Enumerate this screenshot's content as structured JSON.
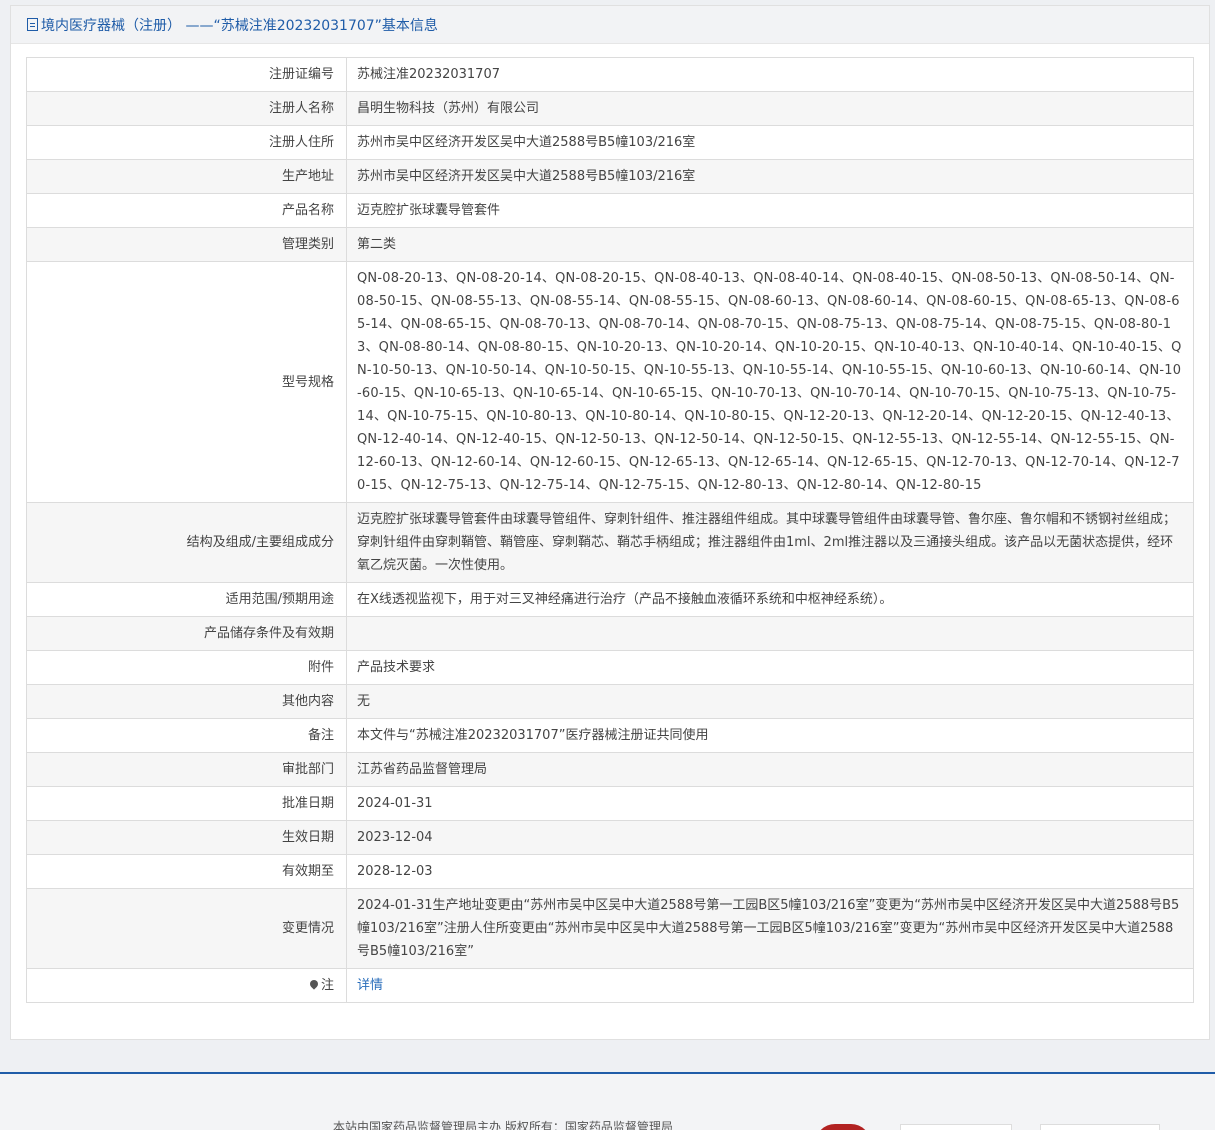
{
  "header": {
    "title": "境内医疗器械（注册） ——“苏械注准20232031707”基本信息"
  },
  "rows": [
    {
      "label": "注册证编号",
      "value": "苏械注准20232031707"
    },
    {
      "label": "注册人名称",
      "value": "昌明生物科技（苏州）有限公司"
    },
    {
      "label": "注册人住所",
      "value": "苏州市吴中区经济开发区吴中大道2588号B5幢103/216室"
    },
    {
      "label": "生产地址",
      "value": "苏州市吴中区经济开发区吴中大道2588号B5幢103/216室"
    },
    {
      "label": "产品名称",
      "value": "迈克腔扩张球囊导管套件"
    },
    {
      "label": "管理类别",
      "value": "第二类"
    },
    {
      "label": "型号规格",
      "value": "QN-08-20-13、QN-08-20-14、QN-08-20-15、QN-08-40-13、QN-08-40-14、QN-08-40-15、QN-08-50-13、QN-08-50-14、QN-08-50-15、QN-08-55-13、QN-08-55-14、QN-08-55-15、QN-08-60-13、QN-08-60-14、QN-08-60-15、QN-08-65-13、QN-08-65-14、QN-08-65-15、QN-08-70-13、QN-08-70-14、QN-08-70-15、QN-08-75-13、QN-08-75-14、QN-08-75-15、QN-08-80-13、QN-08-80-14、QN-08-80-15、QN-10-20-13、QN-10-20-14、QN-10-20-15、QN-10-40-13、QN-10-40-14、QN-10-40-15、QN-10-50-13、QN-10-50-14、QN-10-50-15、QN-10-55-13、QN-10-55-14、QN-10-55-15、QN-10-60-13、QN-10-60-14、QN-10-60-15、QN-10-65-13、QN-10-65-14、QN-10-65-15、QN-10-70-13、QN-10-70-14、QN-10-70-15、QN-10-75-13、QN-10-75-14、QN-10-75-15、QN-10-80-13、QN-10-80-14、QN-10-80-15、QN-12-20-13、QN-12-20-14、QN-12-20-15、QN-12-40-13、QN-12-40-14、QN-12-40-15、QN-12-50-13、QN-12-50-14、QN-12-50-15、QN-12-55-13、QN-12-55-14、QN-12-55-15、QN-12-60-13、QN-12-60-14、QN-12-60-15、QN-12-65-13、QN-12-65-14、QN-12-65-15、QN-12-70-13、QN-12-70-14、QN-12-70-15、QN-12-75-13、QN-12-75-14、QN-12-75-15、QN-12-80-13、QN-12-80-14、QN-12-80-15"
    },
    {
      "label": "结构及组成/主要组成成分",
      "value": "迈克腔扩张球囊导管套件由球囊导管组件、穿刺针组件、推注器组件组成。其中球囊导管组件由球囊导管、鲁尔座、鲁尔帽和不锈钢衬丝组成；穿刺针组件由穿刺鞘管、鞘管座、穿刺鞘芯、鞘芯手柄组成；推注器组件由1ml、2ml推注器以及三通接头组成。该产品以无菌状态提供，经环氧乙烷灭菌。一次性使用。"
    },
    {
      "label": "适用范围/预期用途",
      "value": "在X线透视监视下，用于对三叉神经痛进行治疗（产品不接触血液循环系统和中枢神经系统）。"
    },
    {
      "label": "产品储存条件及有效期",
      "value": ""
    },
    {
      "label": "附件",
      "value": "产品技术要求"
    },
    {
      "label": "其他内容",
      "value": "无"
    },
    {
      "label": "备注",
      "value": "本文件与“苏械注准20232031707”医疗器械注册证共同使用"
    },
    {
      "label": "审批部门",
      "value": "江苏省药品监督管理局"
    },
    {
      "label": "批准日期",
      "value": "2024-01-31"
    },
    {
      "label": "生效日期",
      "value": "2023-12-04"
    },
    {
      "label": "有效期至",
      "value": "2028-12-03"
    },
    {
      "label": "变更情况",
      "value": "2024-01-31生产地址变更由“苏州市吴中区吴中大道2588号第一工园B区5幢103/216室”变更为“苏州市吴中区经济开发区吴中大道2588号B5幢103/216室”注册人住所变更由“苏州市吴中区吴中大道2588号第一工园B区5幢103/216室”变更为“苏州市吴中区经济开发区吴中大道2588号B5幢103/216室”"
    }
  ],
  "note": {
    "label": "注",
    "link_text": "详情"
  },
  "footer": {
    "text": "本站由国家药品监督管理局主办 版权所有：国家药品监督管理局"
  },
  "icons": {
    "header": "document-icon",
    "note": "map-pin-icon"
  },
  "colors": {
    "accent": "#1f5ca8",
    "link": "#2a6ebb"
  }
}
